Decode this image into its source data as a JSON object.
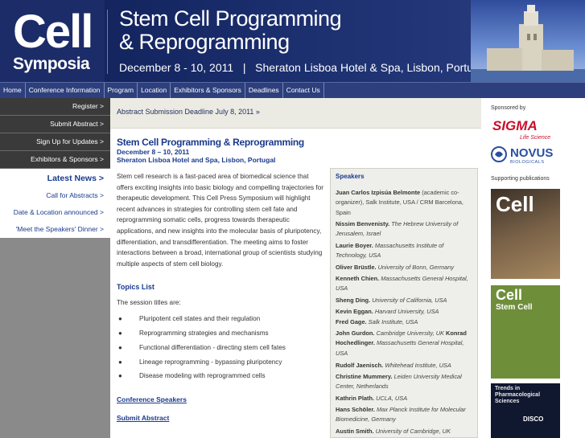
{
  "header": {
    "logo_line1": "Cell",
    "logo_line2": "Symposia",
    "title_line1": "Stem Cell Programming",
    "title_line2": "& Reprogramming",
    "dates_location": "December 8 - 10, 2011   |   Sheraton Lisboa Hotel & Spa, Lisbon, Portugal"
  },
  "nav": {
    "items": [
      {
        "label": "Home"
      },
      {
        "label": "Conference Information"
      },
      {
        "label": "Program"
      },
      {
        "label": "Location"
      },
      {
        "label": "Exhibitors & Sponsors"
      },
      {
        "label": "Deadlines"
      },
      {
        "label": "Contact Us"
      }
    ]
  },
  "sidebar": {
    "buttons": [
      {
        "label": "Register >"
      },
      {
        "label": "Submit Abstract >"
      },
      {
        "label": "Sign Up for Updates >"
      },
      {
        "label": "Exhibitors & Sponsors >"
      }
    ],
    "latest_news": "Latest News >",
    "news_links": [
      {
        "label": "Call for Abstracts >"
      },
      {
        "label": "Date & Location announced >"
      },
      {
        "label": "'Meet the Speakers' Dinner >"
      }
    ]
  },
  "deadline_strip": "Abstract Submission Deadline July 8, 2011 »",
  "main": {
    "title": "Stem Cell Programming & Reprogramming",
    "subtitle_dates": "December 8 – 10, 2011",
    "subtitle_venue": "Sheraton Lisboa Hotel and Spa, Lisbon, Portugal",
    "body": "Stem cell research is a fast-paced area of biomedical science that offers exciting insights into basic biology and compelling trajectories for therapeutic development. This Cell Press Symposium will highlight recent advances in strategies for controlling stem cell fate and reprogramming somatic cells, progress towards therapeutic applications, and new insights into the molecular basis of pluripotency, differentiation, and transdifferentiation. The meeting aims to foster interactions between a broad, international group of scientists studying multiple aspects of stem cell biology.",
    "topics_heading": "Topics List",
    "topics_intro": "The session titles are:",
    "topics": [
      "Pluripotent cell states and their regulation",
      "Reprogramming strategies and mechanisms",
      "Functional differentiation - directing stem cell fates",
      "Lineage reprogramming - bypassing pluripotency",
      "Disease modeling with reprogrammed cells"
    ],
    "link_speakers": "Conference Speakers",
    "link_abstract": "Submit Abstract"
  },
  "speakers": {
    "heading": "Speakers",
    "list": [
      {
        "name": "Juan Carlos Izpisúa Belmonte",
        "affiliation": "(academic co-organizer), Salk Institute, USA / CRM Barcelona, Spain"
      },
      {
        "name": "Nissim Benvenisty.",
        "affiliation": "The Hebrew University of Jerusalem, Israel"
      },
      {
        "name": "Laurie Boyer.",
        "affiliation": "Massachusetts Institute of Technology, USA"
      },
      {
        "name": "Oliver Brüstle.",
        "affiliation": "University of Bonn, Germany"
      },
      {
        "name": "Kenneth Chien.",
        "affiliation": "Massachusetts General Hospital, USA"
      },
      {
        "name": "Sheng Ding.",
        "affiliation": "University of California, USA"
      },
      {
        "name": "Kevin Eggan.",
        "affiliation": "Harvard University, USA"
      },
      {
        "name": "Fred Gage.",
        "affiliation": "Salk Institute, USA"
      },
      {
        "name": "John Gurdon.",
        "affiliation": "Cambridge University, UK"
      },
      {
        "name": "Konrad Hochedlinger.",
        "affiliation": "Massachusetts General Hospital, USA"
      },
      {
        "name": "Rudolf Jaenisch.",
        "affiliation": "Whitehead Institute, USA"
      },
      {
        "name": "Christine Mummery.",
        "affiliation": "Leiden University Medical Center, Netherlands"
      },
      {
        "name": "Kathrin Plath.",
        "affiliation": "UCLA, USA"
      },
      {
        "name": "Hans Schöler.",
        "affiliation": "Max Planck Institute for Molecular Biomedicine, Germany"
      },
      {
        "name": "Austin Smith.",
        "affiliation": "University of Cambridge, UK"
      }
    ]
  },
  "right": {
    "sponsored_by": "Sponsored by",
    "sigma": "SIGMA",
    "sigma_sub": "Life Science",
    "novus": "NOVUS",
    "novus_sub": "BIOLOGICALS",
    "supporting": "Supporting publications",
    "journal_cell": "Cell",
    "journal_cellstem_1": "Cell",
    "journal_cellstem_2": "Stem Cell",
    "journal_trends": "Trends in Pharmacological Sciences",
    "journal_trends_sub": "DISCO"
  },
  "colors": {
    "header_bg": "#1a2d6c",
    "nav_bg": "#2d3f7c",
    "link": "#1a3a8c",
    "sidebar_dark": "#3a3a3a",
    "sidebar_grey": "#8a8a8a",
    "sigma_red": "#c8102e",
    "novus_blue": "#2a4fa0"
  }
}
